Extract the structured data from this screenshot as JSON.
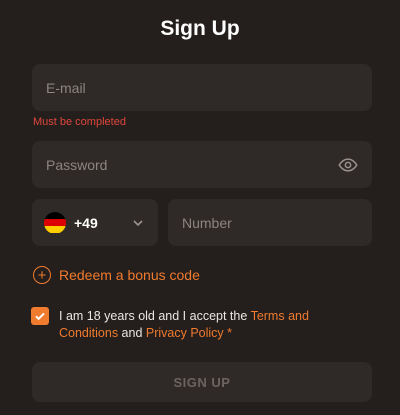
{
  "title": "Sign Up",
  "email": {
    "placeholder": "E-mail",
    "value": ""
  },
  "email_error": "Must be completed",
  "password": {
    "placeholder": "Password",
    "value": ""
  },
  "phone": {
    "country_code": "+49",
    "flag_icon": "germany-flag-icon",
    "number_placeholder": "Number",
    "number_value": ""
  },
  "bonus": {
    "label": "Redeem a bonus code",
    "icon": "plus-circle-icon"
  },
  "consent": {
    "checked": true,
    "text_before": "I am 18 years old and I accept the ",
    "terms_link": "Terms and Conditions",
    "text_middle": " and ",
    "privacy_link": "Privacy Policy",
    "required_mark": " *"
  },
  "submit_label": "SIGN UP",
  "colors": {
    "accent": "#f07a2d",
    "background": "#241f1c",
    "field": "#2f2a27",
    "error": "#e0463c"
  }
}
